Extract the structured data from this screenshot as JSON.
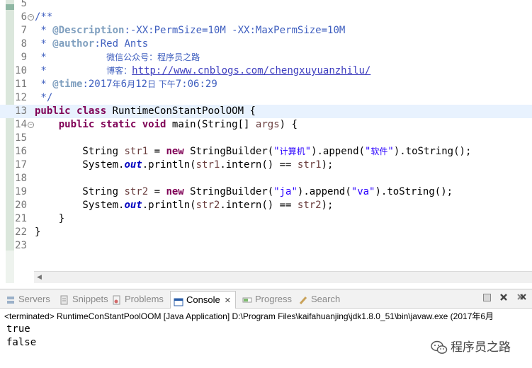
{
  "editor": {
    "lines": [
      {
        "n": "5",
        "segs": []
      },
      {
        "n": "6",
        "fold": true,
        "segs": [
          {
            "c": "cm",
            "t": "/**"
          }
        ]
      },
      {
        "n": "7",
        "segs": [
          {
            "c": "cm",
            "t": " * "
          },
          {
            "c": "tag",
            "t": "@Description"
          },
          {
            "c": "cm",
            "t": ":-XX:PermSize=10M -XX:MaxPermSize=10M"
          }
        ]
      },
      {
        "n": "8",
        "segs": [
          {
            "c": "cm",
            "t": " * "
          },
          {
            "c": "tag",
            "t": "@author"
          },
          {
            "c": "cm",
            "t": ":Red Ants"
          }
        ]
      },
      {
        "n": "9",
        "segs": [
          {
            "c": "cm",
            "t": " *          "
          },
          {
            "c": "cm cjk",
            "t": "微信公众号：程序员之路"
          }
        ]
      },
      {
        "n": "10",
        "segs": [
          {
            "c": "cm",
            "t": " *          "
          },
          {
            "c": "cm cjk",
            "t": "博客："
          },
          {
            "c": "url",
            "t": "http://www.cnblogs.com/chengxuyuanzhilu/"
          }
        ]
      },
      {
        "n": "11",
        "segs": [
          {
            "c": "cm",
            "t": " * "
          },
          {
            "c": "tag",
            "t": "@time"
          },
          {
            "c": "cm",
            "t": ":2017"
          },
          {
            "c": "cm cjk",
            "t": "年"
          },
          {
            "c": "cm",
            "t": "6"
          },
          {
            "c": "cm cjk",
            "t": "月"
          },
          {
            "c": "cm",
            "t": "12"
          },
          {
            "c": "cm cjk",
            "t": "日 下午"
          },
          {
            "c": "cm",
            "t": "7:06:29"
          }
        ]
      },
      {
        "n": "12",
        "segs": [
          {
            "c": "cm",
            "t": " */"
          }
        ]
      },
      {
        "n": "13",
        "current": true,
        "segs": [
          {
            "c": "kw",
            "t": "public"
          },
          {
            "c": "pl",
            "t": " "
          },
          {
            "c": "kw",
            "t": "class"
          },
          {
            "c": "pl",
            "t": " RuntimeConStantPoolOOM {"
          }
        ]
      },
      {
        "n": "14",
        "fold": true,
        "segs": [
          {
            "c": "pl",
            "t": "    "
          },
          {
            "c": "kw",
            "t": "public"
          },
          {
            "c": "pl",
            "t": " "
          },
          {
            "c": "kw",
            "t": "static"
          },
          {
            "c": "pl",
            "t": " "
          },
          {
            "c": "kw",
            "t": "void"
          },
          {
            "c": "pl",
            "t": " main(String[] "
          },
          {
            "c": "var",
            "t": "args"
          },
          {
            "c": "pl",
            "t": ") {"
          }
        ]
      },
      {
        "n": "15",
        "segs": []
      },
      {
        "n": "16",
        "segs": [
          {
            "c": "pl",
            "t": "        String "
          },
          {
            "c": "var",
            "t": "str1"
          },
          {
            "c": "pl",
            "t": " = "
          },
          {
            "c": "kw",
            "t": "new"
          },
          {
            "c": "pl",
            "t": " StringBuilder("
          },
          {
            "c": "str",
            "t": "\""
          },
          {
            "c": "str cjk",
            "t": "计算机"
          },
          {
            "c": "str",
            "t": "\""
          },
          {
            "c": "pl",
            "t": ").append("
          },
          {
            "c": "str",
            "t": "\""
          },
          {
            "c": "str cjk",
            "t": "软件"
          },
          {
            "c": "str",
            "t": "\""
          },
          {
            "c": "pl",
            "t": ").toString();"
          }
        ]
      },
      {
        "n": "17",
        "segs": [
          {
            "c": "pl",
            "t": "        System."
          },
          {
            "c": "fld",
            "t": "out"
          },
          {
            "c": "pl",
            "t": ".println("
          },
          {
            "c": "var",
            "t": "str1"
          },
          {
            "c": "pl",
            "t": ".intern() == "
          },
          {
            "c": "var",
            "t": "str1"
          },
          {
            "c": "pl",
            "t": ");"
          }
        ]
      },
      {
        "n": "18",
        "segs": []
      },
      {
        "n": "19",
        "segs": [
          {
            "c": "pl",
            "t": "        String "
          },
          {
            "c": "var",
            "t": "str2"
          },
          {
            "c": "pl",
            "t": " = "
          },
          {
            "c": "kw",
            "t": "new"
          },
          {
            "c": "pl",
            "t": " StringBuilder("
          },
          {
            "c": "str",
            "t": "\"ja\""
          },
          {
            "c": "pl",
            "t": ").append("
          },
          {
            "c": "str",
            "t": "\"va\""
          },
          {
            "c": "pl",
            "t": ").toString();"
          }
        ]
      },
      {
        "n": "20",
        "segs": [
          {
            "c": "pl",
            "t": "        System."
          },
          {
            "c": "fld",
            "t": "out"
          },
          {
            "c": "pl",
            "t": ".println("
          },
          {
            "c": "var",
            "t": "str2"
          },
          {
            "c": "pl",
            "t": ".intern() == "
          },
          {
            "c": "var",
            "t": "str2"
          },
          {
            "c": "pl",
            "t": ");"
          }
        ]
      },
      {
        "n": "21",
        "segs": [
          {
            "c": "pl",
            "t": "    }"
          }
        ]
      },
      {
        "n": "22",
        "segs": [
          {
            "c": "pl",
            "t": "}"
          }
        ]
      },
      {
        "n": "23",
        "segs": []
      }
    ]
  },
  "console_panel": {
    "tabs": [
      {
        "label": "Servers",
        "icon": "servers-icon"
      },
      {
        "label": "Snippets",
        "icon": "snippets-icon"
      },
      {
        "label": "Problems",
        "icon": "problems-icon"
      },
      {
        "label": "Console",
        "icon": "console-icon",
        "active": true,
        "close": "✕"
      },
      {
        "label": "Progress",
        "icon": "progress-icon"
      },
      {
        "label": "Search",
        "icon": "search-icon"
      }
    ],
    "terminated": "<terminated> RuntimeConStantPoolOOM [Java Application] D:\\Program Files\\kaifahuanjing\\jdk1.8.0_51\\bin\\javaw.exe (2017年6月",
    "output": [
      "true",
      "false"
    ]
  },
  "watermark": {
    "text": "程序员之路"
  },
  "colors": {
    "keyword": "#7f0055",
    "comment": "#3f5fbf",
    "string": "#2a00ff",
    "local_var": "#6a3e3e",
    "field": "#0000c0",
    "current_line": "#e8f2fe"
  }
}
